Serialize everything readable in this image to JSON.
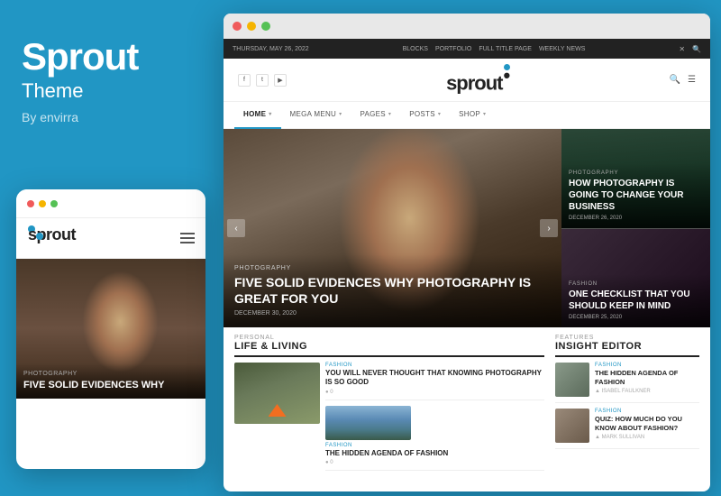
{
  "brand": {
    "title": "Sprout",
    "subtitle": "Theme",
    "by": "By envirra"
  },
  "mobile": {
    "logo": "sprout",
    "hero_category": "PHOTOGRAPHY",
    "hero_title": "FIVE SOLID EVIDENCES WHY"
  },
  "desktop": {
    "window_dots": [
      "#f05a5a",
      "#f5b400",
      "#55c155"
    ],
    "topbar": {
      "date": "THURSDAY, MAY 26, 2022",
      "nav_items": [
        "BLOCKS",
        "PORTFOLIO",
        "FULL TITLE PAGE",
        "WEEKLY NEWS"
      ]
    },
    "header": {
      "social": [
        "f",
        "t",
        "▶"
      ],
      "logo": "sprout",
      "logo_dot": "●"
    },
    "nav": {
      "items": [
        {
          "label": "HOME",
          "active": true
        },
        {
          "label": "MEGA MENU",
          "active": false
        },
        {
          "label": "PAGES",
          "active": false
        },
        {
          "label": "POSTS",
          "active": false
        },
        {
          "label": "SHOP",
          "active": false
        }
      ]
    },
    "hero_main": {
      "category": "PHOTOGRAPHY",
      "title": "FIVE SOLID EVIDENCES WHY PHOTOGRAPHY IS GREAT FOR YOU",
      "date": "DECEMBER 30, 2020"
    },
    "hero_side_1": {
      "category": "PHOTOGRAPHY",
      "title": "HOW PHOTOGRAPHY IS GOING TO CHANGE YOUR BUSINESS",
      "date": "DECEMBER 26, 2020"
    },
    "hero_side_2": {
      "category": "FASHION",
      "title": "ONE CHECKLIST THAT YOU SHOULD KEEP IN MIND",
      "date": "DECEMBER 25, 2020"
    },
    "life_living": {
      "section_sub": "PERSONAL",
      "section_title": "LIFE & LIVING",
      "articles": [
        {
          "category": "FASHION",
          "title": "YOU WILL NEVER THOUGHT THAT KNOWING PHOTOGRAPHY IS SO GOOD",
          "meta": "● 0"
        },
        {
          "category": "FASHION",
          "title": "THE HIDDEN AGENDA OF FASHION",
          "meta": "● 0"
        }
      ]
    },
    "insight": {
      "section_sub": "FEATURES",
      "section_title": "INSIGHT EDITOR",
      "articles": [
        {
          "category": "FASHION",
          "title": "THE HIDDEN AGENDA OF FASHION",
          "author": "▲ ISABEL FAULKNER"
        },
        {
          "category": "FASHION",
          "title": "QUIZ: HOW MUCH DO YOU KNOW ABOUT FASHION?",
          "author": "▲ MARK SULLIVAN"
        }
      ]
    }
  }
}
